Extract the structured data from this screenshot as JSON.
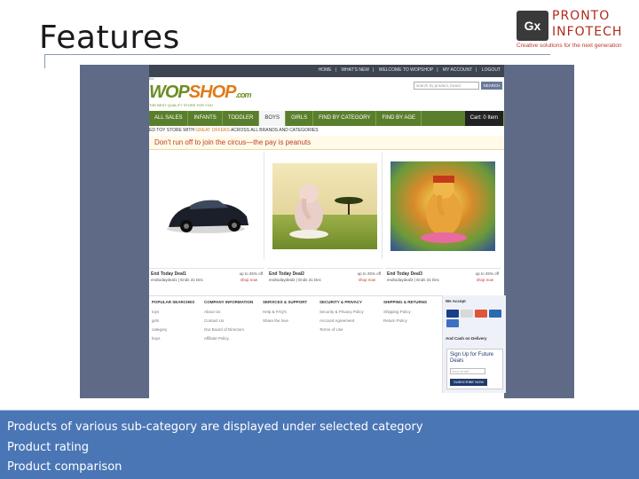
{
  "slide": {
    "title": "Features",
    "bullets": [
      "Products of various sub-category are displayed under selected category",
      "Product rating",
      "Product comparison"
    ]
  },
  "logo": {
    "mark": "Gx",
    "name_line1": "PRONTO",
    "name_line2": "INFOTECH",
    "tagline": "Creative solutions for the next generation"
  },
  "website": {
    "top_nav": [
      "HOME",
      "WHAT'S NEW",
      "WELCOME TO WOPSHOP",
      "MY ACCOUNT",
      "LOGOUT"
    ],
    "brand": {
      "small": "the",
      "name_part1": "WOP",
      "name_part2": "SHOP",
      "domain": ".com",
      "subtitle": "THE BEST QUALITY STORE FOR YOU"
    },
    "search": {
      "placeholder": "search by product, brand",
      "button": "SEARCH"
    },
    "nav": [
      "ALL SALES",
      "INFANTS",
      "TODDLER",
      "BOYS",
      "GIRLS",
      "FIND BY CATEGORY",
      "FIND BY AGE",
      "Cart: 0 Item"
    ],
    "active_nav": "BOYS",
    "promo": {
      "before": "ED TOY STORE WITH ",
      "highlight": "GREAT OFFERS",
      "after": " ACROSS ALL BRANDS AND CATEGORIES"
    },
    "tagline": "Don't run off to join the circus—the pay is peanuts",
    "deals": [
      {
        "name": "End Today Deal1",
        "ends": "endtodaydeal1 | Ends 31 Dec",
        "offer": "up to 25% off",
        "cta": "shop now"
      },
      {
        "name": "End Today Deal2",
        "ends": "endtodaydeal2 | Ends 31 Dec",
        "offer": "up to 25% off",
        "cta": "shop now"
      },
      {
        "name": "End Today Deal3",
        "ends": "endtodaydeal3 | Ends 31 Dec",
        "offer": "up to 25% off",
        "cta": "shop now"
      }
    ],
    "footer_columns": [
      {
        "heading": "POPULAR SEARCHES",
        "items": [
          "toys",
          "girls",
          "category",
          "boys"
        ]
      },
      {
        "heading": "COMPANY INFORMATION",
        "items": [
          "About Us",
          "Contact Us",
          "Our Board of Directors",
          "Affiliate Policy"
        ]
      },
      {
        "heading": "SERVICES & SUPPORT",
        "items": [
          "Help & FAQ's",
          "Share the love"
        ]
      },
      {
        "heading": "SECURITY & PRIVACY",
        "items": [
          "Security & Privacy Policy",
          "Account Agreement",
          "Terms of Use"
        ]
      },
      {
        "heading": "SHIPPING & RETURNS",
        "items": [
          "Shipping Policy",
          "Return Policy"
        ]
      }
    ],
    "accept": {
      "heading": "We Accept",
      "cod": "And Cash on Delivery",
      "signup_title": "Sign Up for Future Deals",
      "signup_placeholder": "Your email",
      "signup_button": "SUBSCRIBE NOW"
    },
    "colors": {
      "nav_green": "#5a7f2c",
      "page_bg": "#5f6b86",
      "caption_blue": "#4a76b5"
    }
  }
}
